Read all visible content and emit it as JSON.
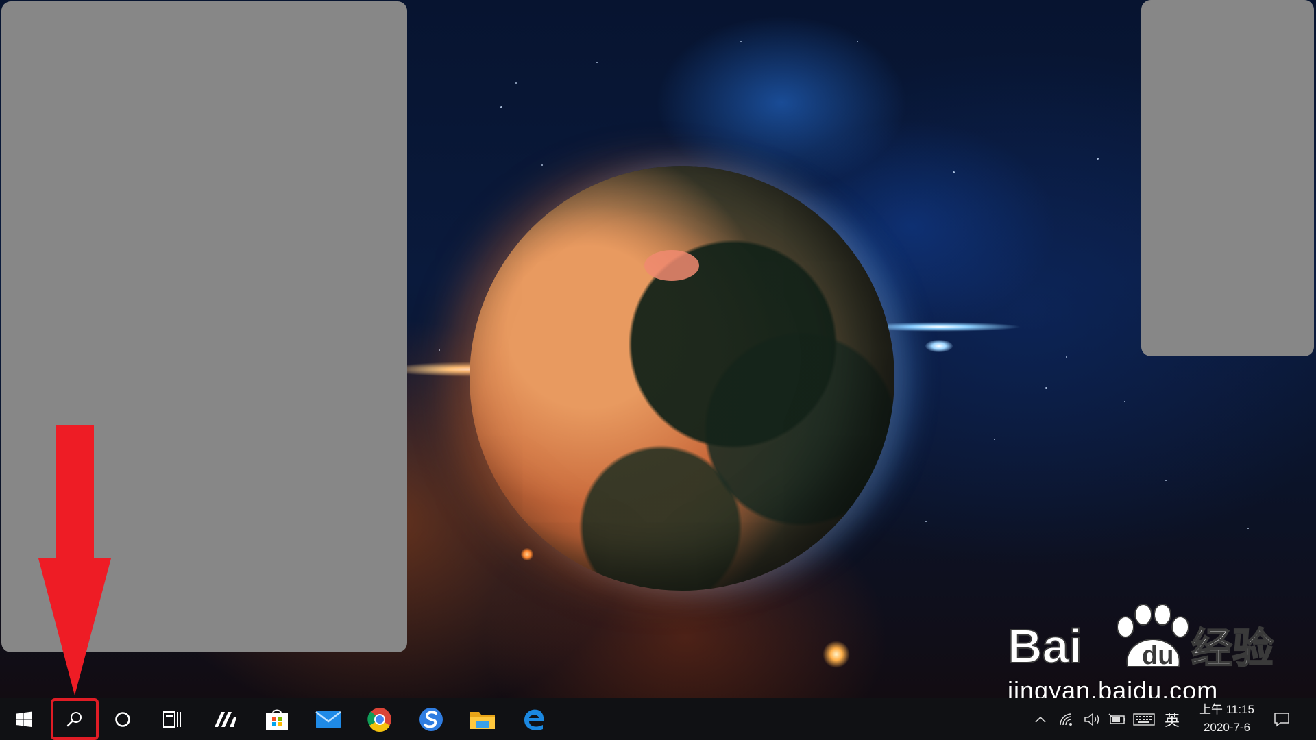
{
  "taskbar": {
    "start_icon": "windows-logo-icon",
    "search_icon": "magnifier-icon",
    "cortana_icon": "circle-icon",
    "task_view_icon": "task-view-icon",
    "pinned_apps": [
      {
        "name": "app-a",
        "icon": "slashes-logo-icon"
      },
      {
        "name": "microsoft-store",
        "icon": "store-bag-icon"
      },
      {
        "name": "mail",
        "icon": "envelope-icon"
      },
      {
        "name": "chrome",
        "icon": "chrome-icon"
      },
      {
        "name": "sogou",
        "icon": "s-circle-icon"
      },
      {
        "name": "file-explorer",
        "icon": "folder-icon"
      },
      {
        "name": "edge",
        "icon": "edge-e-icon"
      }
    ],
    "tray": {
      "ime_label": "英",
      "time": "上午 11:15",
      "date": "2020-7-6"
    }
  },
  "watermark": {
    "logo_text_left": "Bai",
    "logo_text_right": "经验",
    "url": "jingyan.baidu.com"
  },
  "colors": {
    "taskbar": "#101114",
    "annotation_red": "#ee1c25",
    "redaction_gray": "#878787"
  }
}
